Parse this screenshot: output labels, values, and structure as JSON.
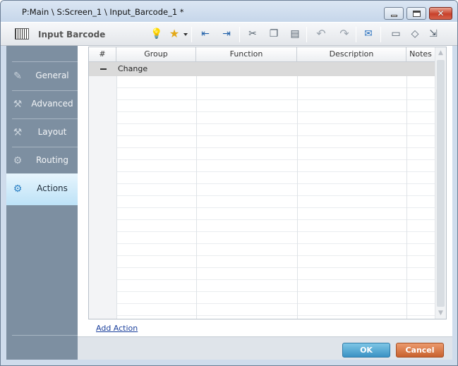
{
  "window": {
    "title": "P:Main \\ S:Screen_1 \\ Input_Barcode_1 *",
    "controls": [
      "minimize",
      "maximize",
      "close"
    ],
    "close_glyph": "✕"
  },
  "toolbar": {
    "title": "Input Barcode",
    "app_icon": "barcode-icon",
    "buttons": [
      {
        "name": "lightbulb-icon",
        "glyph": "💡"
      },
      {
        "name": "star-icon",
        "glyph": "★"
      },
      {
        "name": "outdent-icon",
        "glyph": "⇤"
      },
      {
        "name": "indent-icon",
        "glyph": "⇥"
      },
      {
        "name": "cut-icon",
        "glyph": "✂"
      },
      {
        "name": "copy-icon",
        "glyph": "❐"
      },
      {
        "name": "paste-icon",
        "glyph": "▤"
      },
      {
        "name": "undo-icon",
        "glyph": "↶"
      },
      {
        "name": "redo-icon",
        "glyph": "↷"
      },
      {
        "name": "comment-icon",
        "glyph": "✉"
      },
      {
        "name": "chat-icon",
        "glyph": "▭"
      },
      {
        "name": "tag-icon",
        "glyph": "◇"
      },
      {
        "name": "export-icon",
        "glyph": "⇲"
      }
    ]
  },
  "sidebar": {
    "items": [
      {
        "label": "General",
        "icon": "general-icon",
        "glyph": "✎",
        "active": false
      },
      {
        "label": "Advanced",
        "icon": "advanced-icon",
        "glyph": "⚒",
        "active": false
      },
      {
        "label": "Layout",
        "icon": "layout-icon",
        "glyph": "⚒",
        "active": false
      },
      {
        "label": "Routing",
        "icon": "routing-icon",
        "glyph": "⚙",
        "active": false
      },
      {
        "label": "Actions",
        "icon": "actions-icon",
        "glyph": "⚙",
        "active": true
      }
    ]
  },
  "grid": {
    "columns": [
      "#",
      "Group",
      "Function",
      "Description",
      "Notes"
    ],
    "group_label": "Change",
    "rows": []
  },
  "links": {
    "add_action": "Add Action"
  },
  "buttons": {
    "ok": "OK",
    "cancel": "Cancel"
  },
  "colors": {
    "ok": "#3a92c4",
    "cancel": "#c8612e",
    "sidebar": "#7d8fa1",
    "sidebar_active": "#bde2f7"
  }
}
